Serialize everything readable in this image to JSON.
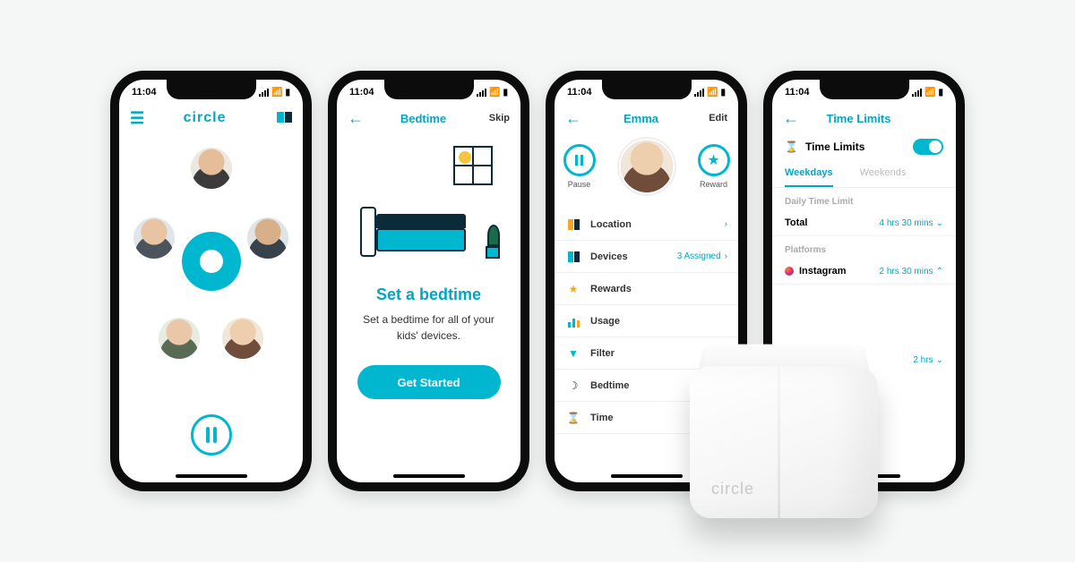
{
  "status": {
    "time": "11:04"
  },
  "phone1": {
    "brand": "circle"
  },
  "phone2": {
    "nav_title": "Bedtime",
    "skip": "Skip",
    "title": "Set a bedtime",
    "subtitle": "Set a bedtime for all of your kids' devices.",
    "cta": "Get Started"
  },
  "phone3": {
    "name": "Emma",
    "edit": "Edit",
    "pause": "Pause",
    "reward": "Reward",
    "rows": {
      "location": "Location",
      "devices": "Devices",
      "devices_value": "3 Assigned",
      "rewards": "Rewards",
      "usage": "Usage",
      "filter": "Filter",
      "bedtime": "Bedtime",
      "time": "Time"
    }
  },
  "phone4": {
    "nav_title": "Time Limits",
    "header": "Time Limits",
    "tab_weekdays": "Weekdays",
    "tab_weekends": "Weekends",
    "section_daily": "Daily Time Limit",
    "total": "Total",
    "total_value": "4 hrs 30 mins",
    "section_platforms": "Platforms",
    "instagram": "Instagram",
    "instagram_value": "2 hrs 30 mins",
    "extra_value": "2 hrs"
  },
  "device": {
    "brand": "circle"
  }
}
